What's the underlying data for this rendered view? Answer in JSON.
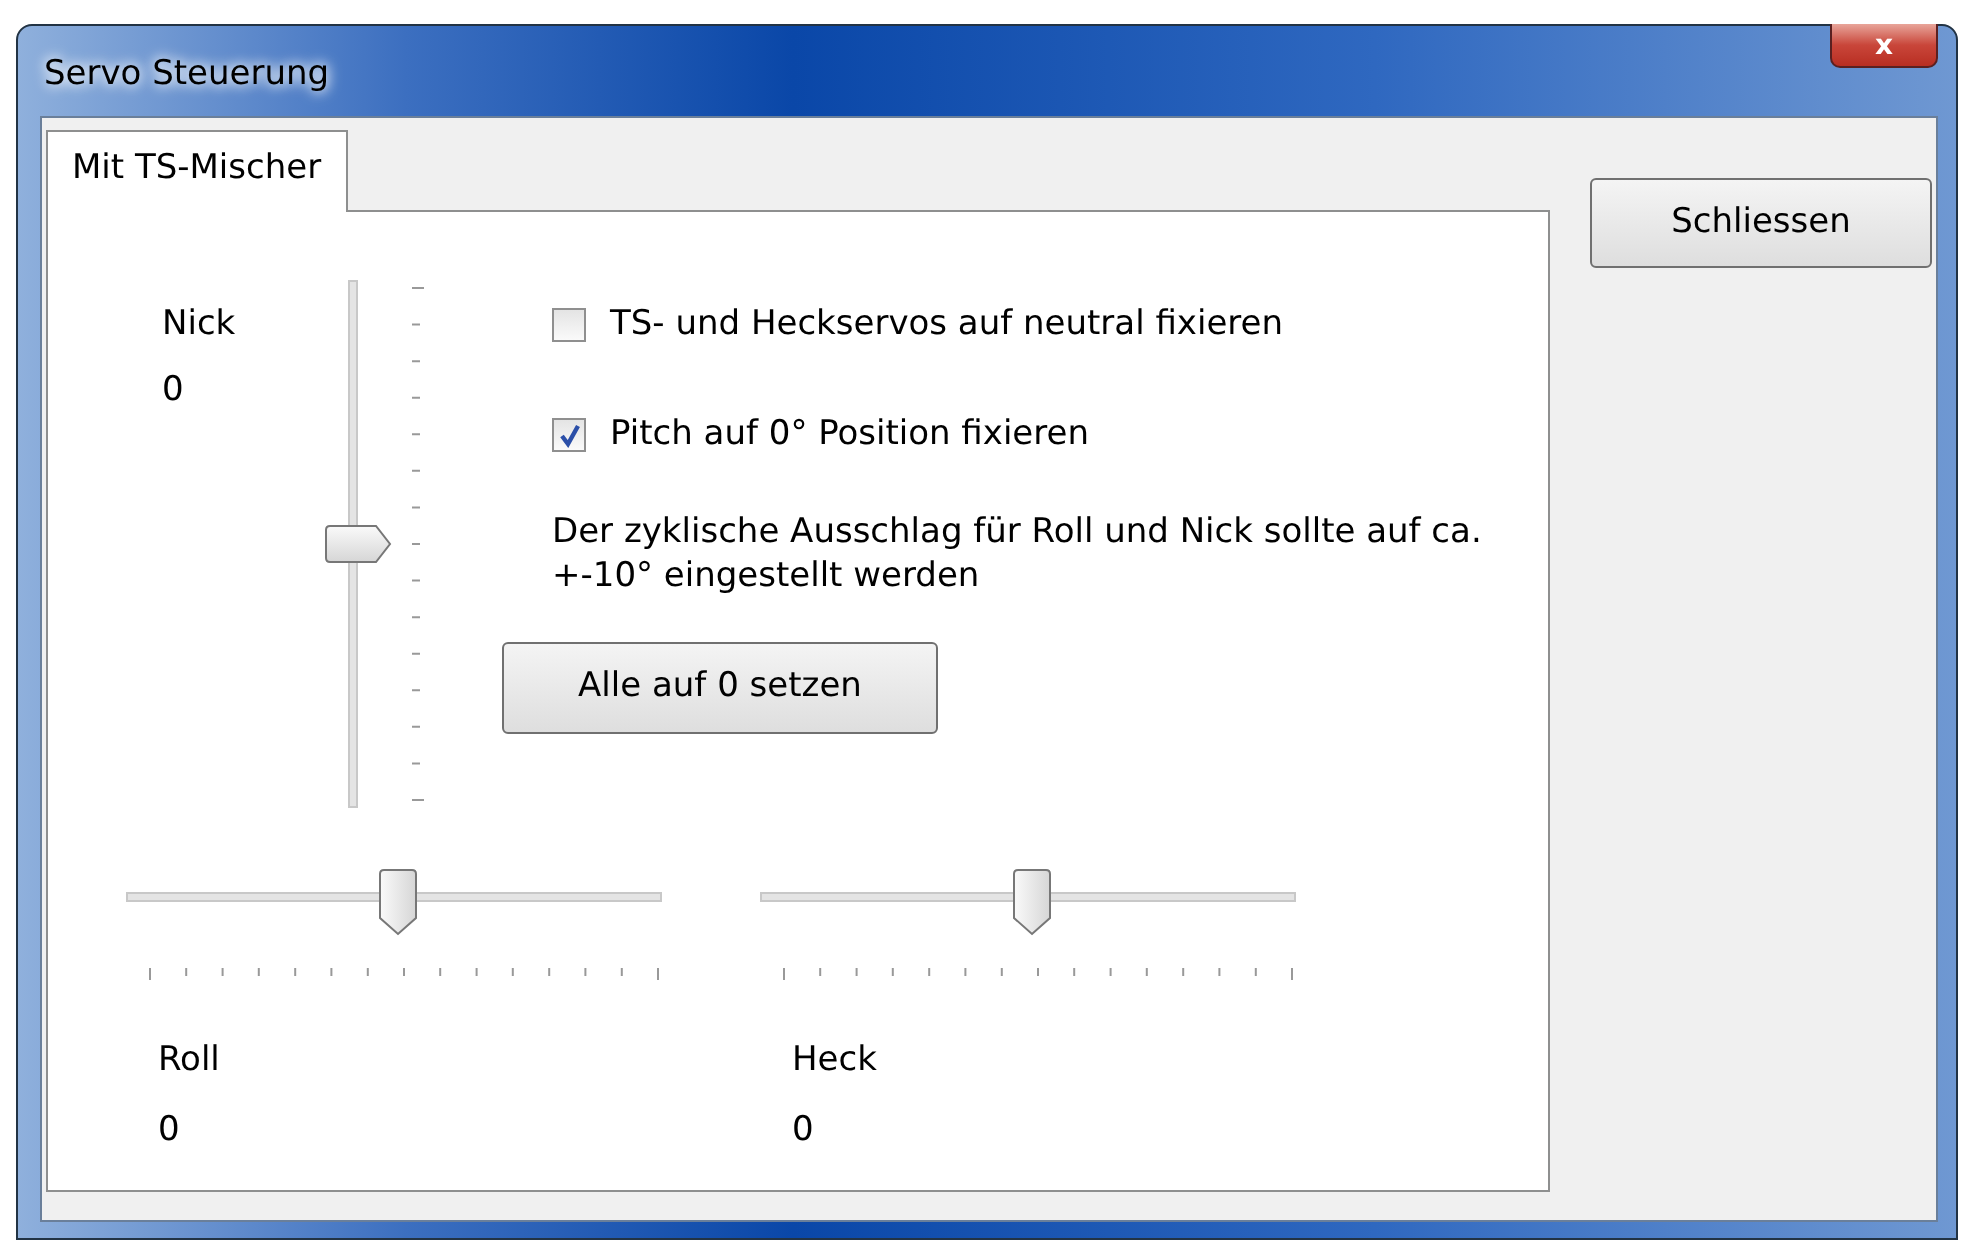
{
  "window": {
    "title": "Servo Steuerung",
    "close_glyph": "x"
  },
  "tabs": [
    {
      "label": "Mit TS-Mischer",
      "selected": true
    }
  ],
  "close_button": "Schliessen",
  "nick": {
    "label": "Nick",
    "value": "0",
    "level": 0.5
  },
  "checkboxes": [
    {
      "label": "TS- und Heckservos auf neutral fixieren",
      "checked": false
    },
    {
      "label": "Pitch auf 0° Position fixieren",
      "checked": true
    }
  ],
  "note": "Der zyklische Ausschlag für Roll und Nick sollte auf ca. +-10° eingestellt werden",
  "reset_button": "Alle auf 0 setzen",
  "sliders": [
    {
      "label": "Roll",
      "value": "0",
      "level": 0.5
    },
    {
      "label": "Heck",
      "value": "0",
      "level": 0.5
    }
  ]
}
